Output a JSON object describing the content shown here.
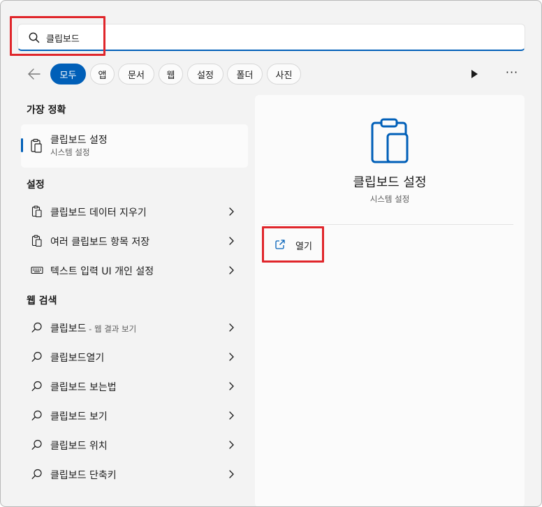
{
  "search": {
    "query": "클립보드",
    "icon": "search-icon"
  },
  "filters": {
    "back_icon": "arrow-left-icon",
    "chips": [
      "모두",
      "앱",
      "문서",
      "웹",
      "설정",
      "폴더",
      "사진"
    ],
    "active_chip": "모두",
    "play_icon": "play-icon",
    "more_label": "···"
  },
  "best_match": {
    "section_title": "가장 정확",
    "title": "클립보드 설정",
    "subtitle": "시스템 설정",
    "icon": "clipboard-icon"
  },
  "settings": {
    "section_title": "설정",
    "items": [
      {
        "label": "클립보드 데이터 지우기",
        "icon": "clipboard-icon"
      },
      {
        "label": "여러 클립보드 항목 저장",
        "icon": "clipboard-icon"
      },
      {
        "label": "텍스트 입력 UI 개인 설정",
        "icon": "keyboard-icon"
      }
    ]
  },
  "web_search": {
    "section_title": "웹 검색",
    "items": [
      {
        "label": "클립보드",
        "suffix": " - 웹 결과 보기"
      },
      {
        "label": "클립보드열기"
      },
      {
        "label": "클립보드 보는법"
      },
      {
        "label": "클립보드 보기"
      },
      {
        "label": "클립보드 위치"
      },
      {
        "label": "클립보드 단축키"
      }
    ]
  },
  "detail": {
    "title": "클립보드 설정",
    "subtitle": "시스템 설정",
    "icon": "clipboard-icon",
    "action_label": "열기",
    "action_icon": "open-external-icon"
  },
  "colors": {
    "accent": "#005fb8",
    "highlight": "#e0262b"
  }
}
